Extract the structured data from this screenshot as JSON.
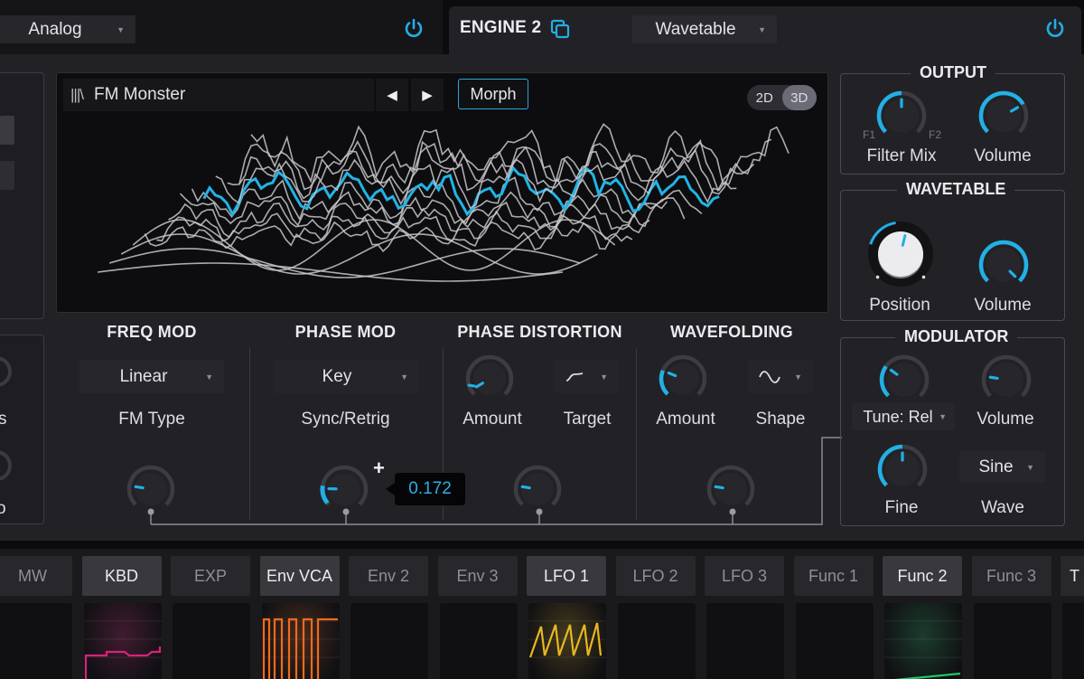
{
  "engine1": {
    "type_value": "Analog",
    "power_on": true
  },
  "engine2": {
    "title": "ENGINE 2",
    "type_value": "Wavetable",
    "power_on": true,
    "copy_icon": "copy-icon"
  },
  "wavetable_view": {
    "browser_icon": "library-icon",
    "preset_name": "FM Monster",
    "prev_label": "◀",
    "next_label": "▶",
    "morph_label": "Morph",
    "view_2d": "2D",
    "view_3d": "3D",
    "active_view": "3D",
    "highlight_color": "#22b4e6"
  },
  "left_partial": {
    "label_a": "s",
    "label_b": "o"
  },
  "freq_mod": {
    "title": "FREQ MOD",
    "type_value": "Linear",
    "type_label": "FM Type",
    "amount_value": 0.2
  },
  "phase_mod": {
    "title": "PHASE MOD",
    "sync_value": "Key",
    "sync_label": "Sync/Retrig",
    "amount_value": 0.172,
    "tooltip_value": "0.172",
    "plus_label": "+"
  },
  "phase_distortion": {
    "title": "PHASE DISTORTION",
    "amount_label": "Amount",
    "target_label": "Target",
    "target_icon": "tilde-wave-icon",
    "amount_value": 0.05,
    "mod_value": 0.2
  },
  "wavefolding": {
    "title": "WAVEFOLDING",
    "amount_label": "Amount",
    "shape_label": "Shape",
    "shape_icon": "sine-wave-icon",
    "amount_value": 0.25,
    "mod_value": 0.2
  },
  "output": {
    "title": "OUTPUT",
    "filter_mix_label": "Filter Mix",
    "f1_label": "F1",
    "f2_label": "F2",
    "filter_mix_value": 0.5,
    "volume_label": "Volume",
    "volume_value": 0.72
  },
  "wavetable": {
    "title": "WAVETABLE",
    "position_label": "Position",
    "position_value": 0.55,
    "volume_label": "Volume",
    "volume_value": 1.0
  },
  "modulator": {
    "title": "MODULATOR",
    "tune_value": "Tune: Rel",
    "tune_amount": 0.3,
    "volume_label": "Volume",
    "volume_value": 0.2,
    "fine_label": "Fine",
    "fine_value": 0.5,
    "wave_value": "Sine",
    "wave_label": "Wave"
  },
  "mod_sources": [
    {
      "label": "MW",
      "state": "off"
    },
    {
      "label": "KBD",
      "state": "active",
      "color": "#d8237a"
    },
    {
      "label": "EXP",
      "state": "off"
    },
    {
      "label": "Env VCA",
      "state": "active",
      "color": "#f06a1e"
    },
    {
      "label": "Env 2",
      "state": "off"
    },
    {
      "label": "Env 3",
      "state": "off"
    },
    {
      "label": "LFO 1",
      "state": "active",
      "color": "#e8b820"
    },
    {
      "label": "LFO 2",
      "state": "off"
    },
    {
      "label": "LFO 3",
      "state": "off"
    },
    {
      "label": "Func 1",
      "state": "off"
    },
    {
      "label": "Func 2",
      "state": "active",
      "color": "#22c46a"
    },
    {
      "label": "Func 3",
      "state": "off"
    },
    {
      "label": "T",
      "state": "lit"
    }
  ]
}
